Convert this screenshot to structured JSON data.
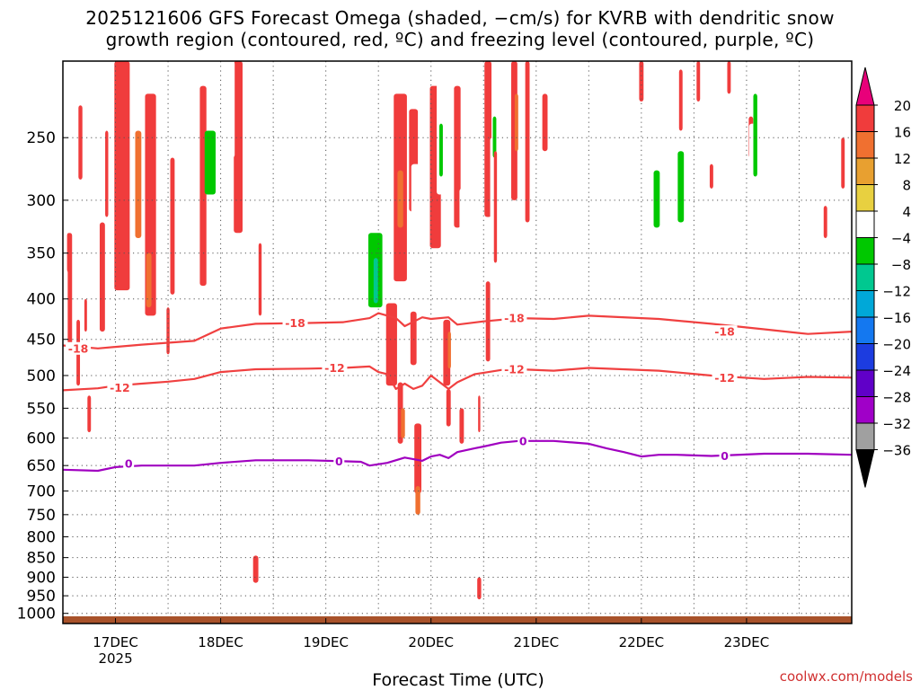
{
  "title": {
    "line1": "2025121606 GFS Forecast Omega (shaded, −cm/s) for KVRB with dendritic snow",
    "line2": "growth region (contoured, red, ºC) and freezing level (contoured, purple, ºC)"
  },
  "credit": "coolwx.com/models",
  "chart_data": {
    "type": "heatmap",
    "xlabel": "Forecast Time (UTC)",
    "ylabel": "",
    "x_ticks": [
      "17DEC",
      "18DEC",
      "19DEC",
      "20DEC",
      "21DEC",
      "22DEC",
      "23DEC"
    ],
    "x_year": "2025",
    "x_range_hours": [
      0,
      180
    ],
    "y_ticks": [
      "250",
      "300",
      "350",
      "400",
      "450",
      "500",
      "550",
      "600",
      "650",
      "700",
      "750",
      "800",
      "850",
      "900",
      "950",
      "1000"
    ],
    "y_range_hpa": [
      200,
      1030
    ],
    "grid": true,
    "colorbar": {
      "labels": [
        "20",
        "16",
        "12",
        "8",
        "4",
        "−4",
        "−8",
        "−12",
        "−16",
        "−20",
        "−24",
        "−28",
        "−32",
        "−36"
      ],
      "colors": [
        "#e8007a",
        "#f03c3c",
        "#f07030",
        "#e8a030",
        "#e8d040",
        "#ffffff",
        "#00c800",
        "#00c890",
        "#00a8d8",
        "#1478f0",
        "#1c3ce0",
        "#6000c8",
        "#a000c8",
        "#a0a0a0",
        "#000000"
      ]
    },
    "contours": [
      {
        "label": "-18",
        "color": "#f04040",
        "x": [
          0,
          8,
          18,
          30,
          36,
          44,
          56,
          64,
          70,
          72,
          76,
          78,
          82,
          84,
          88,
          90,
          96,
          104,
          112,
          120,
          136,
          148,
          160,
          170,
          180
        ],
        "y": [
          458,
          462,
          457,
          452,
          436,
          430,
          429,
          428,
          423,
          417,
          423,
          433,
          422,
          424,
          422,
          431,
          427,
          423,
          424,
          420,
          424,
          430,
          437,
          443,
          440
        ]
      },
      {
        "label": "-12",
        "color": "#f04040",
        "x": [
          0,
          8,
          12,
          18,
          24,
          30,
          36,
          44,
          56,
          64,
          70,
          72,
          74,
          76,
          78,
          80,
          82,
          84,
          88,
          90,
          94,
          96,
          100,
          104,
          112,
          120,
          136,
          148,
          160,
          170,
          180
        ],
        "y": [
          522,
          519,
          515,
          512,
          509,
          505,
          495,
          491,
          490,
          489,
          487,
          495,
          498,
          520,
          512,
          520,
          515,
          500,
          520,
          510,
          498,
          496,
          492,
          491,
          493,
          489,
          493,
          500,
          505,
          502,
          503
        ]
      },
      {
        "label": "0",
        "color": "#a000c0",
        "x": [
          0,
          8,
          12,
          18,
          30,
          36,
          44,
          56,
          64,
          68,
          70,
          74,
          78,
          80,
          82,
          84,
          86,
          88,
          90,
          94,
          96,
          100,
          104,
          112,
          120,
          124,
          128,
          132,
          136,
          140,
          148,
          160,
          170,
          180
        ],
        "y": [
          658,
          660,
          653,
          650,
          650,
          645,
          640,
          640,
          642,
          643,
          650,
          645,
          635,
          638,
          641,
          633,
          630,
          636,
          625,
          618,
          615,
          608,
          605,
          605,
          610,
          618,
          625,
          633,
          630,
          630,
          632,
          628,
          628,
          630
        ]
      }
    ],
    "contour_labels": [
      {
        "text": "-18",
        "x": 3.5,
        "y": 462
      },
      {
        "text": "-18",
        "x": 53,
        "y": 429
      },
      {
        "text": "-18",
        "x": 103,
        "y": 423
      },
      {
        "text": "-18",
        "x": 151,
        "y": 440
      },
      {
        "text": "-12",
        "x": 13,
        "y": 518
      },
      {
        "text": "-12",
        "x": 62,
        "y": 489
      },
      {
        "text": "-12",
        "x": 103,
        "y": 491
      },
      {
        "text": "-12",
        "x": 151,
        "y": 503
      },
      {
        "text": "0",
        "x": 15,
        "y": 646
      },
      {
        "text": "0",
        "x": 63,
        "y": 642
      },
      {
        "text": "0",
        "x": 105,
        "y": 605
      },
      {
        "text": "0",
        "x": 151,
        "y": 632
      }
    ],
    "shaded_regions": [
      {
        "x": 4,
        "p": 255,
        "w": 0.9,
        "h": 55,
        "c": 1
      },
      {
        "x": 1.6,
        "p": 400,
        "w": 1.0,
        "h": 140,
        "c": 1
      },
      {
        "x": 3.5,
        "p": 470,
        "w": 0.8,
        "h": 90,
        "c": 1
      },
      {
        "x": 6,
        "p": 560,
        "w": 0.8,
        "h": 60,
        "c": 1
      },
      {
        "x": 1.3,
        "p": 350,
        "w": 0.7,
        "h": 40,
        "c": 1
      },
      {
        "x": 5.2,
        "p": 420,
        "w": 0.6,
        "h": 40,
        "c": 1
      },
      {
        "x": 9,
        "p": 380,
        "w": 1.2,
        "h": 120,
        "c": 1
      },
      {
        "x": 10,
        "p": 280,
        "w": 0.7,
        "h": 70,
        "c": 1
      },
      {
        "x": 13.5,
        "p": 270,
        "w": 3.5,
        "h": 240,
        "c": 1
      },
      {
        "x": 12.5,
        "p": 230,
        "w": 1.3,
        "h": 90,
        "c": 1
      },
      {
        "x": 20,
        "p": 320,
        "w": 2.5,
        "h": 200,
        "c": 1
      },
      {
        "x": 17.2,
        "p": 290,
        "w": 1.4,
        "h": 90,
        "c": 2
      },
      {
        "x": 19.6,
        "p": 380,
        "w": 1.2,
        "h": 60,
        "c": 2
      },
      {
        "x": 25,
        "p": 330,
        "w": 1.0,
        "h": 130,
        "c": 1
      },
      {
        "x": 24,
        "p": 440,
        "w": 0.7,
        "h": 60,
        "c": 1
      },
      {
        "x": 32,
        "p": 300,
        "w": 1.5,
        "h": 170,
        "c": 1
      },
      {
        "x": 40,
        "p": 260,
        "w": 2.0,
        "h": 140,
        "c": 1
      },
      {
        "x": 38.5,
        "p": 230,
        "w": 1.4,
        "h": 70,
        "c": 5
      },
      {
        "x": 42,
        "p": 420,
        "w": 0.8,
        "h": 90,
        "c": 5
      },
      {
        "x": 45.5,
        "p": 505,
        "w": 0.6,
        "h": 60,
        "c": 5
      },
      {
        "x": 45,
        "p": 380,
        "w": 0.7,
        "h": 80,
        "c": 1
      },
      {
        "x": 44,
        "p": 880,
        "w": 1.2,
        "h": 70,
        "c": 1
      },
      {
        "x": 46.5,
        "p": 920,
        "w": 1.1,
        "h": 70,
        "c": 5
      },
      {
        "x": 33.6,
        "p": 270,
        "w": 2.5,
        "h": 50,
        "c": 6
      },
      {
        "x": 55,
        "p": 260,
        "w": 1.0,
        "h": 40,
        "c": 5
      },
      {
        "x": 61,
        "p": 230,
        "w": 1.8,
        "h": 90,
        "c": 5
      },
      {
        "x": 65,
        "p": 330,
        "w": 0.9,
        "h": 50,
        "c": 5
      },
      {
        "x": 71,
        "p": 260,
        "w": 1.6,
        "h": 110,
        "c": 5
      },
      {
        "x": 71.3,
        "p": 350,
        "w": 5.5,
        "h": 120,
        "c": 5
      },
      {
        "x": 71.3,
        "p": 370,
        "w": 3.2,
        "h": 80,
        "c": 6
      },
      {
        "x": 71.4,
        "p": 380,
        "w": 1.0,
        "h": 50,
        "c": 7
      },
      {
        "x": 77,
        "p": 300,
        "w": 3.0,
        "h": 160,
        "c": 1
      },
      {
        "x": 77,
        "p": 300,
        "w": 1.3,
        "h": 50,
        "c": 2
      },
      {
        "x": 80,
        "p": 270,
        "w": 2.0,
        "h": 80,
        "c": 1
      },
      {
        "x": 80.5,
        "p": 320,
        "w": 2.0,
        "h": 100,
        "c": 5
      },
      {
        "x": 85,
        "p": 280,
        "w": 2.5,
        "h": 130,
        "c": 1
      },
      {
        "x": 86,
        "p": 250,
        "w": 1.4,
        "h": 90,
        "c": 5
      },
      {
        "x": 86.3,
        "p": 260,
        "w": 0.8,
        "h": 40,
        "c": 6
      },
      {
        "x": 90,
        "p": 270,
        "w": 1.5,
        "h": 110,
        "c": 1
      },
      {
        "x": 91,
        "p": 330,
        "w": 1.0,
        "h": 80,
        "c": 5
      },
      {
        "x": 75,
        "p": 460,
        "w": 2.5,
        "h": 110,
        "c": 1
      },
      {
        "x": 77,
        "p": 560,
        "w": 1.2,
        "h": 100,
        "c": 1
      },
      {
        "x": 77.6,
        "p": 575,
        "w": 0.9,
        "h": 50,
        "c": 2
      },
      {
        "x": 81,
        "p": 640,
        "w": 1.6,
        "h": 130,
        "c": 1
      },
      {
        "x": 81,
        "p": 720,
        "w": 1.1,
        "h": 60,
        "c": 2
      },
      {
        "x": 80,
        "p": 450,
        "w": 1.4,
        "h": 70,
        "c": 1
      },
      {
        "x": 87.6,
        "p": 470,
        "w": 1.6,
        "h": 90,
        "c": 1
      },
      {
        "x": 88,
        "p": 550,
        "w": 1.0,
        "h": 60,
        "c": 1
      },
      {
        "x": 88.2,
        "p": 465,
        "w": 0.7,
        "h": 50,
        "c": 2
      },
      {
        "x": 91,
        "p": 580,
        "w": 1.0,
        "h": 60,
        "c": 1
      },
      {
        "x": 78.5,
        "p": 790,
        "w": 0.5,
        "h": 40,
        "c": 5
      },
      {
        "x": 97,
        "p": 250,
        "w": 1.6,
        "h": 130,
        "c": 1
      },
      {
        "x": 98,
        "p": 300,
        "w": 1.0,
        "h": 100,
        "c": 5
      },
      {
        "x": 98.5,
        "p": 250,
        "w": 0.8,
        "h": 30,
        "c": 6
      },
      {
        "x": 98.7,
        "p": 310,
        "w": 0.7,
        "h": 100,
        "c": 1
      },
      {
        "x": 103,
        "p": 250,
        "w": 1.4,
        "h": 100,
        "c": 1
      },
      {
        "x": 103.5,
        "p": 240,
        "w": 0.8,
        "h": 40,
        "c": 2
      },
      {
        "x": 106,
        "p": 260,
        "w": 1.0,
        "h": 120,
        "c": 1
      },
      {
        "x": 108,
        "p": 400,
        "w": 0.9,
        "h": 60,
        "c": 5
      },
      {
        "x": 97,
        "p": 430,
        "w": 1.0,
        "h": 100,
        "c": 1
      },
      {
        "x": 95,
        "p": 560,
        "w": 0.5,
        "h": 60,
        "c": 1
      },
      {
        "x": 95,
        "p": 930,
        "w": 0.9,
        "h": 60,
        "c": 1
      },
      {
        "x": 98,
        "p": 930,
        "w": 0.6,
        "h": 60,
        "c": 5
      },
      {
        "x": 110,
        "p": 240,
        "w": 1.2,
        "h": 40,
        "c": 1
      },
      {
        "x": 126,
        "p": 330,
        "w": 0.6,
        "h": 70,
        "c": 5
      },
      {
        "x": 130,
        "p": 270,
        "w": 1.1,
        "h": 90,
        "c": 5
      },
      {
        "x": 135.5,
        "p": 300,
        "w": 3.2,
        "h": 80,
        "c": 5
      },
      {
        "x": 135.5,
        "p": 300,
        "w": 1.4,
        "h": 50,
        "c": 6
      },
      {
        "x": 141,
        "p": 300,
        "w": 2.6,
        "h": 90,
        "c": 5
      },
      {
        "x": 141,
        "p": 290,
        "w": 1.4,
        "h": 60,
        "c": 6
      },
      {
        "x": 145,
        "p": 210,
        "w": 0.8,
        "h": 30,
        "c": 1
      },
      {
        "x": 141,
        "p": 225,
        "w": 0.8,
        "h": 40,
        "c": 1
      },
      {
        "x": 148,
        "p": 280,
        "w": 0.8,
        "h": 20,
        "c": 1
      },
      {
        "x": 157,
        "p": 250,
        "w": 1.0,
        "h": 30,
        "c": 1
      },
      {
        "x": 157.5,
        "p": 290,
        "w": 1.8,
        "h": 100,
        "c": 5
      },
      {
        "x": 158,
        "p": 250,
        "w": 0.9,
        "h": 60,
        "c": 6
      },
      {
        "x": 163.5,
        "p": 270,
        "w": 1.2,
        "h": 140,
        "c": 5
      },
      {
        "x": 174,
        "p": 320,
        "w": 0.8,
        "h": 30,
        "c": 1
      },
      {
        "x": 178,
        "p": 270,
        "w": 0.8,
        "h": 40,
        "c": 1
      },
      {
        "x": 132,
        "p": 210,
        "w": 1.0,
        "h": 30,
        "c": 1
      },
      {
        "x": 152,
        "p": 210,
        "w": 0.8,
        "h": 20,
        "c": 1
      }
    ]
  }
}
